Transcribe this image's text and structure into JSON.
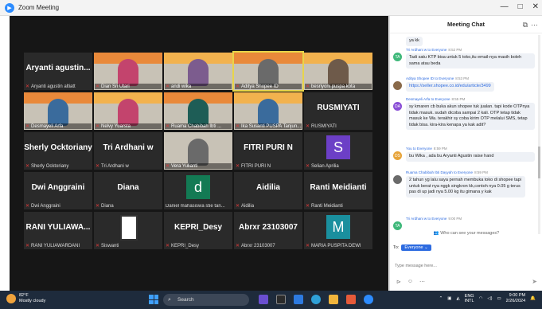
{
  "window": {
    "title": "Zoom Meeting",
    "controls": [
      "—",
      "□",
      "✕"
    ]
  },
  "gallery": {
    "row1": [
      {
        "name": "Aryanti agustin...",
        "caption": "Aryanti agustin altiatt",
        "type": "name"
      },
      {
        "caption": "Dian Sri Utari",
        "type": "photo"
      },
      {
        "caption": "andi wika",
        "type": "photo"
      },
      {
        "caption": "Aditya Shopee ID",
        "type": "photo"
      },
      {
        "caption": "besriyoni puspa kota",
        "type": "photo"
      }
    ],
    "row2": [
      {
        "caption": "Desmayeli Arfa",
        "type": "photo"
      },
      {
        "caption": "Nelvy Yuarsta",
        "type": "photo"
      },
      {
        "caption": "Ruama Chabibah Ibti ...",
        "type": "photo"
      },
      {
        "caption": "Ika Susanti PUSPA Tanjun...",
        "type": "photo"
      },
      {
        "name": "RUSMIYATI",
        "caption": "RUSMIYATI",
        "type": "name"
      }
    ],
    "row3": [
      {
        "name": "Sherly Ocktoriany",
        "caption": "Sherly Ocktoriany",
        "type": "name"
      },
      {
        "name": "Tri Ardhani w",
        "caption": "Tri Ardhani w",
        "type": "name"
      },
      {
        "caption": "Vera Yulianti",
        "type": "photo"
      },
      {
        "name": "FITRI PURI N",
        "caption": "FITRI PURI N",
        "type": "name"
      },
      {
        "letter": "S",
        "caption": "Selian Aprilia",
        "type": "letter",
        "color": "#6c3fc6"
      }
    ],
    "row4": [
      {
        "name": "Dwi Anggraini",
        "caption": "Dwi Anggraini",
        "type": "name"
      },
      {
        "name": "Diana",
        "caption": "Diana",
        "type": "name"
      },
      {
        "letter": "d",
        "caption": "Daniel mahasiswa stie tan...",
        "type": "letter",
        "color": "#137a54"
      },
      {
        "name": "Aidilia",
        "caption": "Aidilia",
        "type": "name"
      },
      {
        "name": "Ranti Meidianti",
        "caption": "Ranti Meidianti",
        "type": "name"
      }
    ],
    "row5": [
      {
        "name": "RANI YULIAWA...",
        "caption": "RANI YULIAWARDANI",
        "type": "name"
      },
      {
        "caption": "Siswanti",
        "type": "phone"
      },
      {
        "name": "KEPRI_Desy",
        "caption": "KEPRI_Desy",
        "type": "name"
      },
      {
        "name": "Abrxr 23103007",
        "caption": "Abrxr 23103007",
        "type": "name"
      },
      {
        "letter": "M",
        "caption": "MARIA PUSPITA DEWI",
        "type": "letter",
        "color": "#1a8f9e"
      }
    ]
  },
  "chat": {
    "title": "Meeting Chat",
    "messages": [
      {
        "meta": "",
        "text": "ya kk",
        "avatar": "",
        "color": ""
      },
      {
        "meta": "Tri Ardhani w to Everyone",
        "time": "8:52 PM",
        "text": "Tadi satu KTP bisa untuk 5 toko,itu email-nya masih boleh sama atau beda",
        "avatar": "TA",
        "color": "#3fb87a"
      },
      {
        "meta": "Aditya Shopee ID to Everyone",
        "time": "8:53 PM",
        "text": "https://seller.shopee.co.id/edu/article/3499",
        "avatar": "",
        "color": "#8a6a4a",
        "link": true
      },
      {
        "meta": "Desmayeli Arfa to Everyone",
        "time": "8:55 PM",
        "text": "sy kmaren cb buka akun shopee tuk jualan. tapi kode OTPnya tidak masuk. sudah dicoba sampai 2 kali. OTP tetap tidak masuk ke Wa. terakhir sy coba kirim OTP melalui SMS, tetap tidak bisa. kira-kira kenapa ya kak adit?",
        "avatar": "DA",
        "color": "#8a4fd6"
      },
      {
        "meta": "You to Everyone",
        "time": "8:59 PM",
        "text": "bu Wika , ada bu Aryanti Agustin raise hand",
        "avatar": "DS",
        "color": "#e7a43a"
      },
      {
        "meta": "Ruama Chabibah Ibti Dayyah to Everyone",
        "time": "8:59 PM",
        "text": "2 tahun yg lalu saya pernah membuka toko di shopee tapi untuk berat nya nggk singkron kk,contoh nya 0.05 g terus pas di up jadi nya 5.00 kg itu gimana y kak",
        "avatar": "",
        "color": "#6a6a6a"
      },
      {
        "meta": "Tri Ardhani w to Everyone",
        "time": "9:00 PM",
        "text": "",
        "avatar": "TA",
        "color": "#3fb87a"
      }
    ],
    "who_can_see": "Who can see your messages?",
    "to_label": "To:",
    "to_value": "Everyone",
    "input_placeholder": "Type message here..."
  },
  "taskbar": {
    "temp": "82°F",
    "weather": "Mostly cloudy",
    "search": "Search",
    "lang": "ENG",
    "lang2": "INTL",
    "time": "9:00 PM",
    "date": "2/26/2024"
  }
}
